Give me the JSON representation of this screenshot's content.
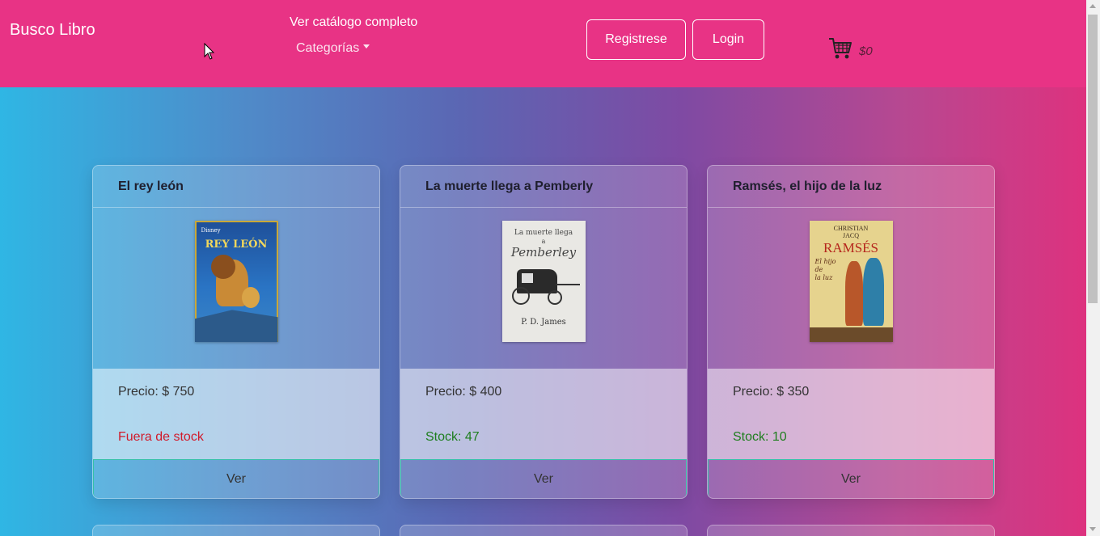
{
  "header": {
    "brand": "Busco Libro",
    "catalog_link": "Ver catálogo completo",
    "categories_label": "Categorías",
    "register_label": "Registrese",
    "login_label": "Login",
    "cart_total": "$0",
    "cart_icon": "cart-icon"
  },
  "books": [
    {
      "title": "El rey león",
      "price": "Precio: $ 750",
      "stock": "Fuera de stock",
      "button": "Ver",
      "cover_text": [
        "Disney",
        "REY LEÓN"
      ]
    },
    {
      "title": "La muerte llega a Pemberly",
      "price": "Precio: $ 400",
      "stock": "Stock: 47",
      "button": "Ver",
      "cover_text": [
        "La muerte llega",
        "a",
        "Pemberley",
        "P. D. James"
      ]
    },
    {
      "title": "Ramsés, el hijo de la luz",
      "price": "Precio: $ 350",
      "stock": "Stock: 10",
      "button": "Ver",
      "cover_text": [
        "CHRISTIAN",
        "JACQ",
        "RAMSÉS",
        "El hijo",
        "de",
        "la luz"
      ]
    }
  ],
  "colors": {
    "navbar": "#e83385",
    "out_of_stock": "#d11a2a",
    "in_stock": "#1e7e1e",
    "button_border": "#35c0a8"
  }
}
